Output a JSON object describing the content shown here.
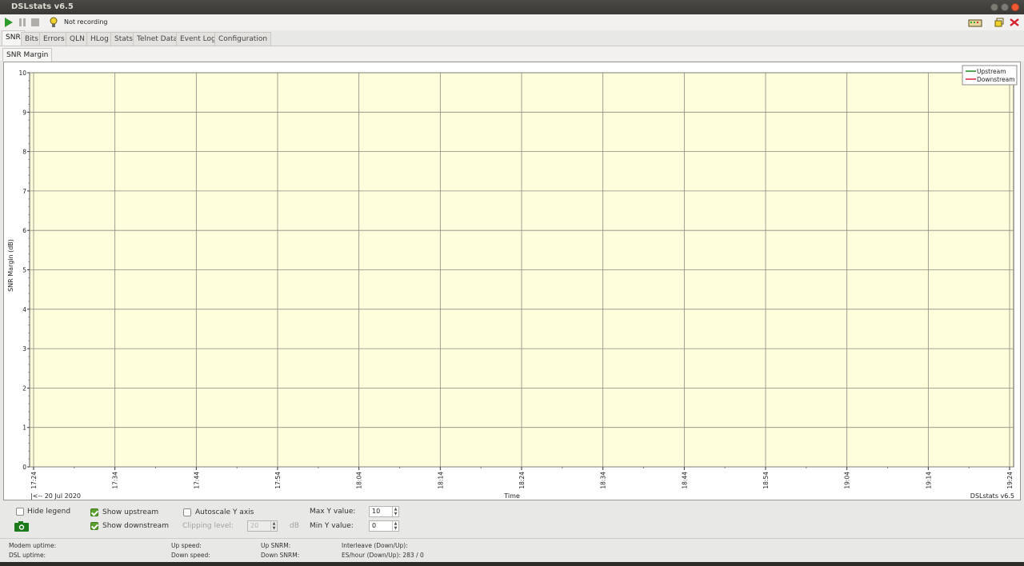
{
  "window": {
    "title": "DSLstats v6.5"
  },
  "toolbar": {
    "recording_status": "Not recording",
    "icons": [
      "play-icon",
      "pause-icon",
      "stop-icon",
      "bulb-icon",
      "router-icon",
      "restore-icon",
      "close-app-icon"
    ]
  },
  "tabs": [
    "SNR",
    "Bits",
    "Errors",
    "QLN",
    "HLog",
    "Stats",
    "Telnet Data",
    "Event Log",
    "Configuration"
  ],
  "active_tab": "SNR",
  "subtab": "SNR Margin",
  "chart": {
    "legend": [
      "Upstream",
      "Downstream"
    ],
    "date_label": "|<-- 20 Jul 2020",
    "footer_brand": "DSLstats v6.5"
  },
  "chart_data": {
    "type": "line",
    "ylabel": "SNR Margin (dB)",
    "xlabel": "Time",
    "ylim": [
      0,
      10
    ],
    "yticks": [
      "0",
      "1",
      "2",
      "3",
      "4",
      "5",
      "6",
      "7",
      "8",
      "9",
      "10"
    ],
    "xticks": [
      "17:24",
      "17:34",
      "17:44",
      "17:54",
      "18:04",
      "18:14",
      "18:24",
      "18:34",
      "18:44",
      "18:54",
      "19:04",
      "19:14",
      "19:24"
    ],
    "series": [
      {
        "name": "Upstream",
        "color": "#1f8a1f",
        "values": []
      },
      {
        "name": "Downstream",
        "color": "#e0213a",
        "values": []
      }
    ],
    "grid": true,
    "legend_position": "top-right",
    "plot_background": "#fffedc"
  },
  "controls": {
    "hide_legend": "Hide legend",
    "hide_legend_checked": false,
    "show_upstream": "Show upstream",
    "show_upstream_checked": true,
    "show_downstream": "Show downstream",
    "show_downstream_checked": true,
    "autoscale": "Autoscale Y axis",
    "autoscale_checked": false,
    "clipping_label": "Clipping level:",
    "clipping_value": "20",
    "clipping_unit": "dB",
    "max_y_label": "Max Y value:",
    "max_y_value": "10",
    "min_y_label": "Min Y value:",
    "min_y_value": "0"
  },
  "status": {
    "modem_uptime": "Modem uptime:",
    "dsl_uptime": "DSL uptime:",
    "up_speed": "Up speed:",
    "down_speed": "Down speed:",
    "up_snrm": "Up SNRM:",
    "down_snrm": "Down SNRM:",
    "interleave": "Interleave (Down/Up):",
    "es_hour": "ES/hour (Down/Up): 283 / 0"
  }
}
